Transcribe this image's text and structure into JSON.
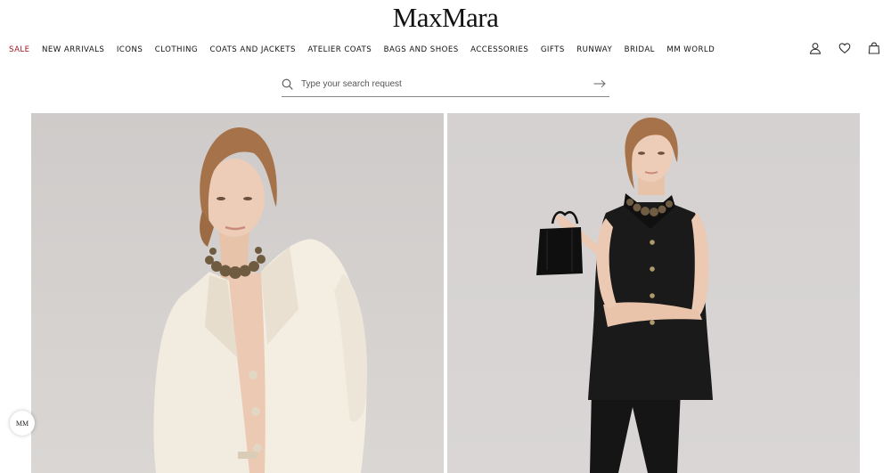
{
  "brand": {
    "logo_text": "MaxMara"
  },
  "nav": {
    "items": [
      {
        "label": "SALE"
      },
      {
        "label": "NEW ARRIVALS"
      },
      {
        "label": "ICONS"
      },
      {
        "label": "CLOTHING"
      },
      {
        "label": "COATS AND JACKETS"
      },
      {
        "label": "ATELIER COATS"
      },
      {
        "label": "BAGS AND SHOES"
      },
      {
        "label": "ACCESSORIES"
      },
      {
        "label": "GIFTS"
      },
      {
        "label": "RUNWAY"
      },
      {
        "label": "BRIDAL"
      },
      {
        "label": "MM WORLD"
      }
    ],
    "sale_color": "#a3121e"
  },
  "utility_icons": [
    "account-icon",
    "wishlist-heart-icon",
    "shopping-bag-icon"
  ],
  "search": {
    "placeholder": "Type your search request",
    "value": ""
  },
  "chat_badge": {
    "label": "MM"
  }
}
